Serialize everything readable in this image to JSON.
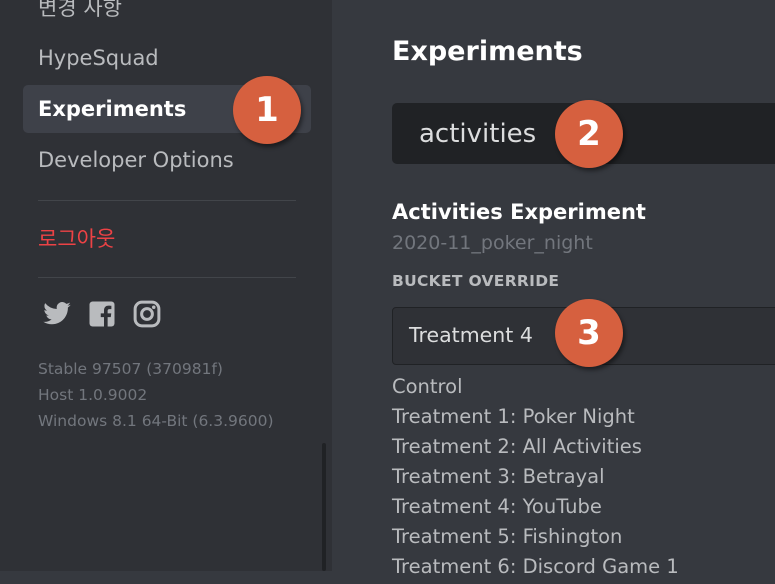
{
  "sidebar": {
    "partial_heading": "변경 사항",
    "items": [
      {
        "label": "HypeSquad"
      },
      {
        "label": "Experiments",
        "active": true
      },
      {
        "label": "Developer Options"
      }
    ],
    "logout_label": "로그아웃",
    "logout_color": "#ed4245",
    "socials": [
      "twitter-icon",
      "facebook-icon",
      "instagram-icon"
    ],
    "version_lines": [
      "Stable 97507 (370981f)",
      "Host 1.0.9002",
      "Windows 8.1 64-Bit (6.3.9600)"
    ]
  },
  "main": {
    "title": "Experiments",
    "search_value": "activities",
    "experiment": {
      "title": "Activities Experiment",
      "id": "2020-11_poker_night",
      "bucket_label": "BUCKET OVERRIDE",
      "selected": "Treatment 4",
      "options": [
        "Control",
        "Treatment 1: Poker Night",
        "Treatment 2: All Activities",
        "Treatment 3: Betrayal",
        "Treatment 4: YouTube",
        "Treatment 5: Fishington",
        "Treatment 6: Discord Game 1"
      ]
    }
  },
  "annotations": [
    "1",
    "2",
    "3"
  ],
  "colors": {
    "background": "#36393f",
    "sidebar": "#2f3136",
    "input": "#202225",
    "badge": "#d6603f"
  }
}
